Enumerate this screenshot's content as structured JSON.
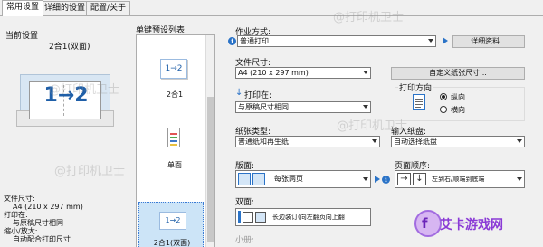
{
  "tabs": [
    "常用设置",
    "详细的设置",
    "配置/关于"
  ],
  "current": {
    "label": "当前设置",
    "preset": "2合1(双面)",
    "preview_text": "1→2",
    "info_lines": [
      "文件尺寸:",
      "A4 (210 x 297 mm)",
      "打印在:",
      "与原稿尺寸相同",
      "缩小/放大:",
      "自动配合打印尺寸"
    ]
  },
  "presets": {
    "label": "单键预设列表:",
    "items": [
      {
        "label": "2合1",
        "thumb": "1→2"
      },
      {
        "label": "单面",
        "thumb": ""
      },
      {
        "label": "2合1(双面)",
        "thumb": "1→2"
      }
    ]
  },
  "job": {
    "label": "作业方式:",
    "value": "普通打印",
    "details_button": "详细资料..."
  },
  "doc_size": {
    "label": "文件尺寸:",
    "value": "A4 (210 x 297 mm)",
    "custom_button": "自定义纸张尺寸..."
  },
  "print_on": {
    "label": "打印在:",
    "value": "与原稿尺寸相同"
  },
  "orientation": {
    "label": "打印方向",
    "options": [
      "纵向",
      "横向"
    ],
    "selected": "纵向"
  },
  "paper_type": {
    "label": "纸张类型:",
    "value": "普通纸和再生纸"
  },
  "input_tray": {
    "label": "输入纸盘:",
    "value": "自动选择纸盘"
  },
  "layout": {
    "label": "版面:",
    "value": "每张两页"
  },
  "page_order": {
    "label": "页面顺序:",
    "value": "左到右/顺端到底端"
  },
  "duplex": {
    "label": "双面:",
    "value": "长边装订(向左翻页向上翻"
  },
  "booklet": {
    "label": "小册:"
  },
  "watermark": {
    "text": "@打印机卫士"
  },
  "overlay_logo": {
    "text": "艾卡游戏网"
  },
  "colors": {
    "accent": "#2b73c7",
    "selected_bg": "#cce4f7",
    "logo": "#8a3ad6"
  }
}
